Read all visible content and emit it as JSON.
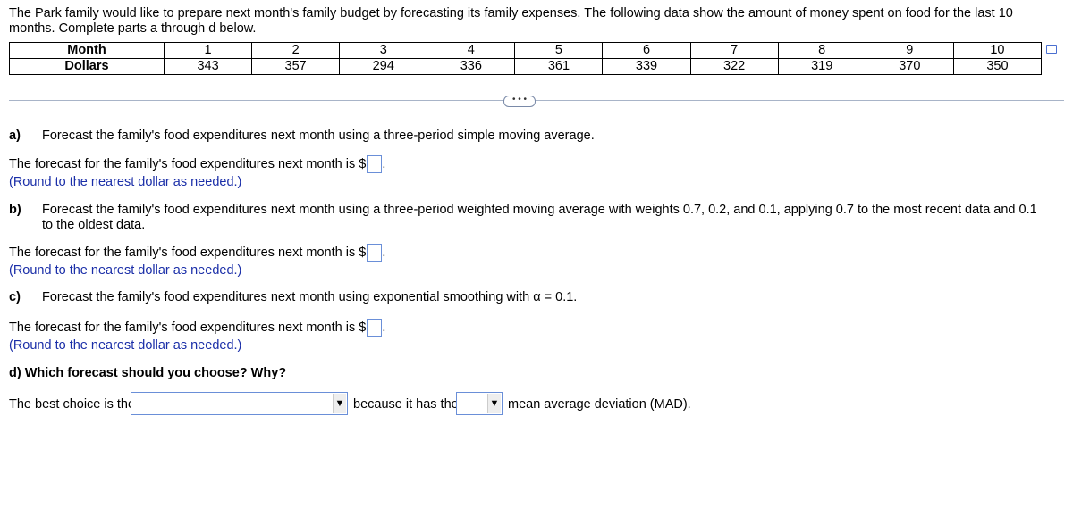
{
  "intro": "The Park family would like to prepare next month's family budget by forecasting its family expenses. The following data show the amount of money spent on food for the last 10 months. Complete parts a through d below.",
  "table": {
    "row_labels": [
      "Month",
      "Dollars"
    ],
    "months": [
      "1",
      "2",
      "3",
      "4",
      "5",
      "6",
      "7",
      "8",
      "9",
      "10"
    ],
    "dollars": [
      "343",
      "357",
      "294",
      "336",
      "361",
      "339",
      "322",
      "319",
      "370",
      "350"
    ]
  },
  "more_label": "• • •",
  "a": {
    "label": "a)",
    "text": "Forecast the family's food expenditures next month using a three-period simple moving average.",
    "answer_prefix": "The forecast for the family's food expenditures next month is $",
    "answer_suffix": ".",
    "hint": "(Round to the nearest dollar as needed.)"
  },
  "b": {
    "label": "b)",
    "text": "Forecast the family's food expenditures next month using a three-period weighted moving average with weights 0.7, 0.2, and 0.1, applying 0.7 to the most recent data and 0.1 to the oldest data.",
    "answer_prefix": "The forecast for the family's food expenditures next month is $",
    "answer_suffix": ".",
    "hint": "(Round to the nearest dollar as needed.)"
  },
  "c": {
    "label": "c)",
    "text": "Forecast the family's food expenditures next month using exponential smoothing with α = 0.1.",
    "answer_prefix": "The forecast for the family's food expenditures next month is $",
    "answer_suffix": ".",
    "hint": "(Round to the nearest dollar as needed.)"
  },
  "d": {
    "label": "d) Which forecast should you choose? Why?",
    "prefix": "The best choice is the",
    "middle": "because it has the",
    "suffix": "mean average deviation (MAD)."
  },
  "icons": {
    "popout": "popout-icon",
    "dropdown": "triangle-down-icon"
  }
}
